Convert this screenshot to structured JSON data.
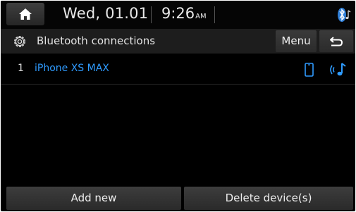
{
  "status_bar": {
    "home_icon": "home-icon",
    "date": "Wed, 01.01",
    "time": "9:26",
    "ampm": "AM",
    "bluetooth_icon": "bluetooth-music-icon"
  },
  "title_bar": {
    "settings_icon": "gear-icon",
    "title": "Bluetooth connections",
    "menu_label": "Menu",
    "back_icon": "back-arrow-icon"
  },
  "devices": [
    {
      "index": "1",
      "name": "iPhone XS MAX",
      "phone_icon": "phone-icon",
      "audio_icon": "bluetooth-audio-icon"
    }
  ],
  "bottom_bar": {
    "add_label": "Add new",
    "delete_label": "Delete device(s)"
  },
  "colors": {
    "accent": "#2f9bff",
    "background": "#000000",
    "button": "#333333"
  }
}
